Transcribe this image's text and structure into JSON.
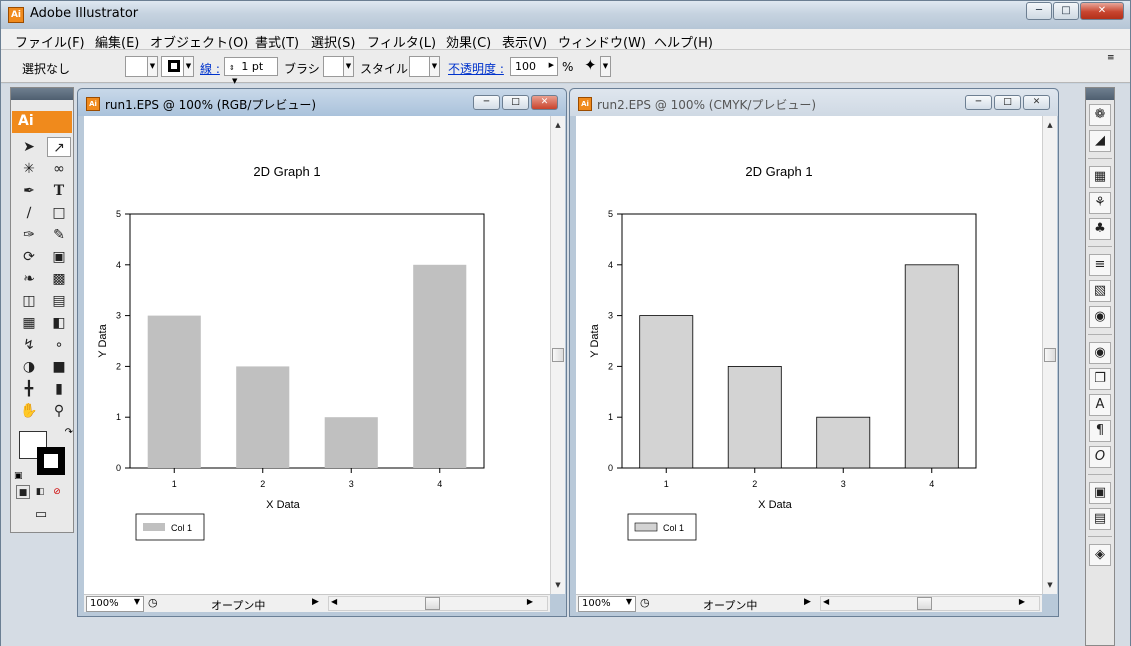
{
  "app": {
    "title": "Adobe Illustrator",
    "logo": "Ai"
  },
  "menu": [
    "ファイル(F)",
    "編集(E)",
    "オブジェクト(O)",
    "書式(T)",
    "選択(S)",
    "フィルタ(L)",
    "効果(C)",
    "表示(V)",
    "ウィンドウ(W)",
    "ヘルプ(H)"
  ],
  "control": {
    "selection": "選択なし",
    "stroke_label": "線 :",
    "stroke_weight": "1 pt",
    "brush_label": "ブラシ :",
    "style_label": "スタイル :",
    "opacity_label": "不透明度 :",
    "opacity_value": "100",
    "percent": "%"
  },
  "documents": [
    {
      "title": "run1.EPS @ 100% (RGB/プレビュー)",
      "active": true,
      "zoom": "100%",
      "status": "オープン中",
      "chart": {
        "title": "2D Graph 1",
        "xlabel": "X Data",
        "ylabel": "Y Data",
        "categories": [
          "1",
          "2",
          "3",
          "4"
        ],
        "yticks": [
          "0",
          "1",
          "2",
          "3",
          "4",
          "5"
        ],
        "legend": "Col 1"
      }
    },
    {
      "title": "run2.EPS @ 100% (CMYK/プレビュー)",
      "active": false,
      "zoom": "100%",
      "status": "オープン中",
      "chart": {
        "title": "2D Graph 1",
        "xlabel": "X Data",
        "ylabel": "Y Data",
        "categories": [
          "1",
          "2",
          "3",
          "4"
        ],
        "yticks": [
          "0",
          "1",
          "2",
          "3",
          "4",
          "5"
        ],
        "legend": "Col 1"
      }
    }
  ],
  "chart_data": [
    {
      "type": "bar",
      "title": "2D Graph 1",
      "xlabel": "X Data",
      "ylabel": "Y Data",
      "categories": [
        "1",
        "2",
        "3",
        "4"
      ],
      "series": [
        {
          "name": "Col 1",
          "values": [
            3,
            2,
            1,
            4
          ]
        }
      ],
      "ylim": [
        0,
        5
      ],
      "bar_color": "#c0c0c0",
      "bar_outline": false,
      "legend": "bottom-left"
    },
    {
      "type": "bar",
      "title": "2D Graph 1",
      "xlabel": "X Data",
      "ylabel": "Y Data",
      "categories": [
        "1",
        "2",
        "3",
        "4"
      ],
      "series": [
        {
          "name": "Col 1",
          "values": [
            3,
            2,
            1,
            4
          ]
        }
      ],
      "ylim": [
        0,
        5
      ],
      "bar_color": "#d3d3d3",
      "bar_outline": true,
      "legend": "bottom-left"
    }
  ]
}
